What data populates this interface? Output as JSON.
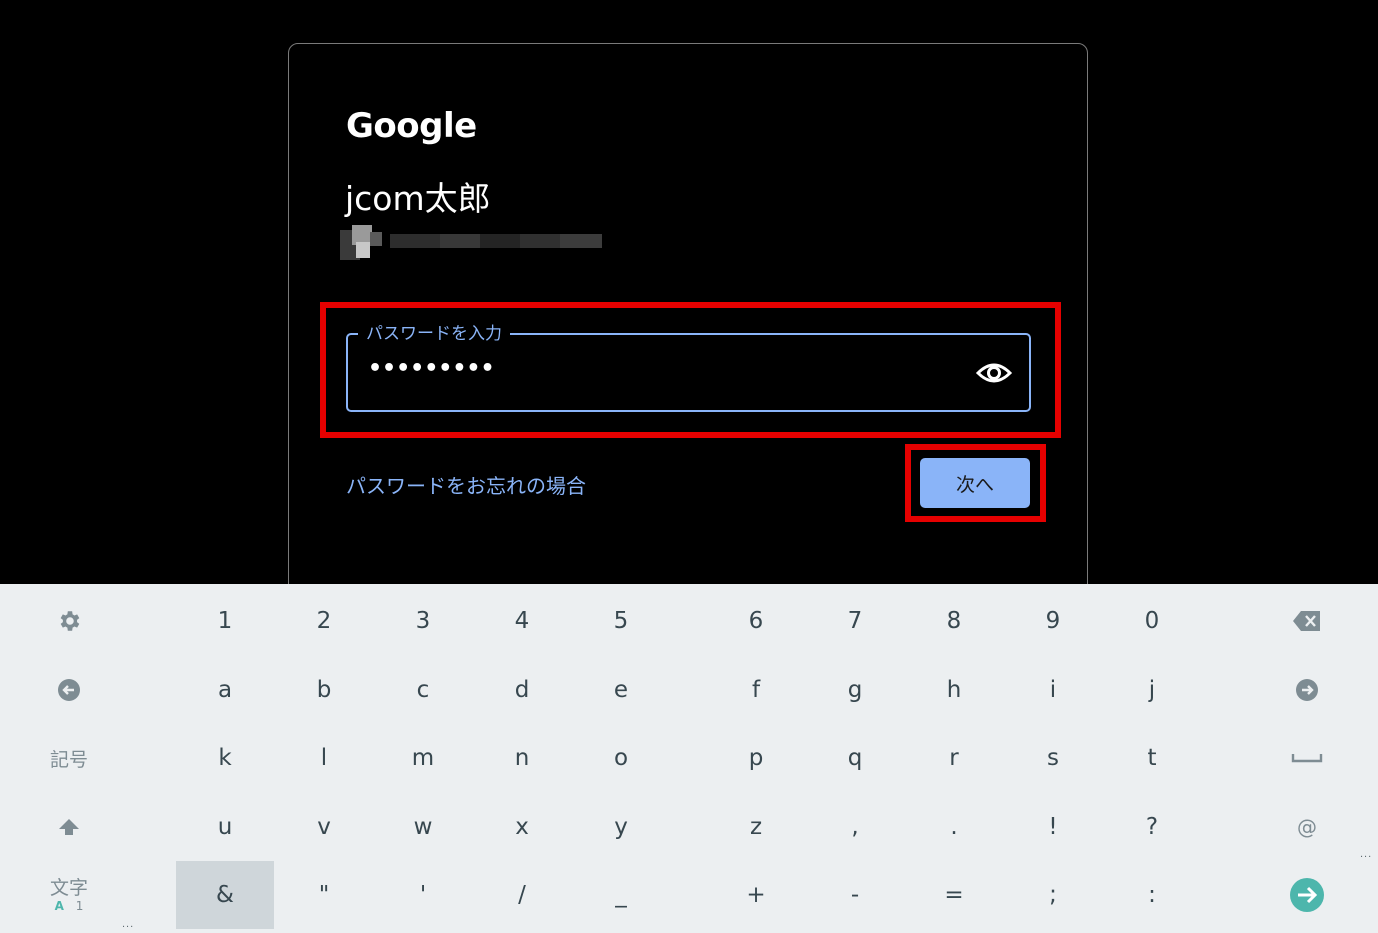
{
  "signin": {
    "logo": "Google",
    "account_name": "jcom太郎",
    "password_label": "パスワードを入力",
    "password_value": "•••••••••",
    "forgot_link": "パスワードをお忘れの場合",
    "next_button": "次へ"
  },
  "keyboard": {
    "rows": [
      [
        "1",
        "2",
        "3",
        "4",
        "5",
        "6",
        "7",
        "8",
        "9",
        "0"
      ],
      [
        "a",
        "b",
        "c",
        "d",
        "e",
        "f",
        "g",
        "h",
        "i",
        "j"
      ],
      [
        "k",
        "l",
        "m",
        "n",
        "o",
        "p",
        "q",
        "r",
        "s",
        "t"
      ],
      [
        "u",
        "v",
        "w",
        "x",
        "y",
        "z",
        ",",
        ".",
        "!",
        "?"
      ],
      [
        "&",
        "\"",
        "'",
        "/",
        "_",
        "+",
        "-",
        "=",
        ";",
        ":"
      ]
    ],
    "symbols_key": "記号",
    "mode_key_main": "文字",
    "mode_key_sub_a": "A",
    "mode_key_sub_1": "1",
    "at_key": "@",
    "accent_color": "#8ab4f8",
    "highlight_color": "#e60000",
    "enter_color": "#4db6ac"
  }
}
